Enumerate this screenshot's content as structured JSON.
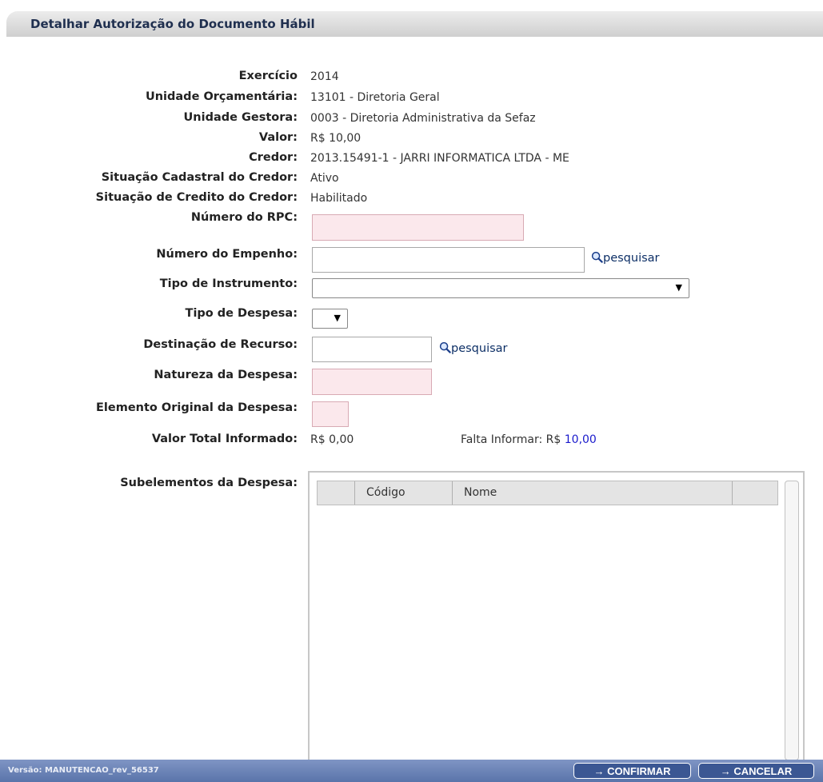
{
  "page": {
    "title": "Detalhar Autorização do Documento Hábil"
  },
  "info": [
    {
      "label": "Exercício",
      "value": "2014"
    },
    {
      "label": "Unidade Orçamentária:",
      "value": "13101 - Diretoria Geral"
    },
    {
      "label": "Unidade Gestora:",
      "value": "0003 - Diretoria Administrativa da Sefaz"
    },
    {
      "label": "Valor:",
      "value": "R$ 10,00"
    },
    {
      "label": "Credor:",
      "value": "2013.15491-1 - JARRI INFORMATICA LTDA - ME"
    },
    {
      "label": "Situação Cadastral do Credor:",
      "value": "Ativo"
    },
    {
      "label": "Situação de Credito do Credor:",
      "value": "Habilitado"
    }
  ],
  "form": {
    "rpc_label": "Número do RPC:",
    "rpc_value": "",
    "empenho_label": "Número do Empenho:",
    "empenho_value": "",
    "instrumento_label": "Tipo de Instrumento:",
    "instrumento_value": "",
    "despesa_label": "Tipo de Despesa:",
    "despesa_value": "",
    "recurso_label": "Destinação de Recurso:",
    "recurso_value": "",
    "natureza_label": "Natureza da Despesa:",
    "natureza_value": "",
    "elemento_label": "Elemento Original da Despesa:",
    "elemento_value": "",
    "search_label": "pesquisar",
    "total_label": "Valor Total Informado:",
    "total_value": "R$ 0,00",
    "falta_label": "Falta Informar: R$",
    "falta_value": "10,00",
    "falta_color": "#1a1acc"
  },
  "subelementos": {
    "label": "Subelementos da Despesa:",
    "columns": [
      "",
      "Código",
      "Nome",
      ""
    ],
    "rows": []
  },
  "footer": {
    "version": "Versão: MANUTENCAO_rev_56537",
    "confirm_label": "→ CONFIRMAR",
    "cancel_label": "→ CANCELAR",
    "bar_color": "#5a74aa"
  }
}
